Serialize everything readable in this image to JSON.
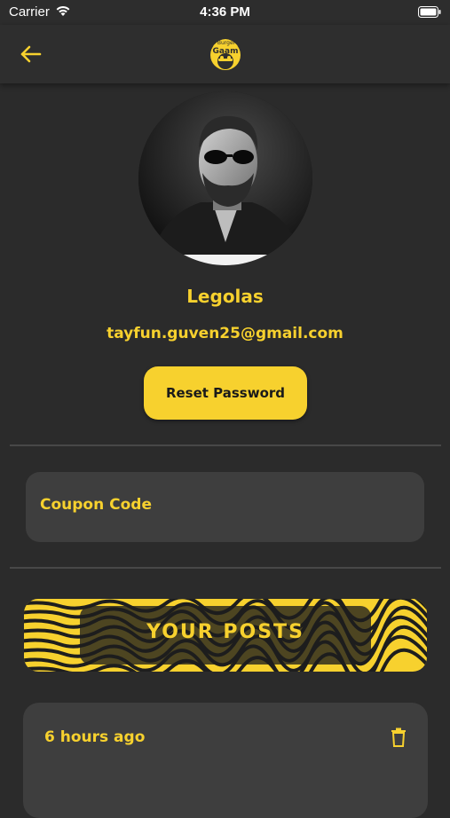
{
  "status_bar": {
    "carrier": "Carrier",
    "time": "4:36 PM"
  },
  "nav": {
    "back_icon": "arrow-left-icon",
    "logo_text_top": "Burger",
    "logo_text_main": "Gaam"
  },
  "profile": {
    "name": "Legolas",
    "email": "tayfun.guven25@gmail.com",
    "reset_password_label": "Reset Password"
  },
  "coupon": {
    "label": "Coupon Code"
  },
  "posts_banner": {
    "title": "YOUR POSTS"
  },
  "posts": [
    {
      "time": "6 hours ago",
      "delete_icon": "trash-icon"
    }
  ],
  "colors": {
    "accent": "#f7d12e",
    "background": "#2b2b2b",
    "card": "#3e3e3e",
    "divider": "#484848"
  }
}
